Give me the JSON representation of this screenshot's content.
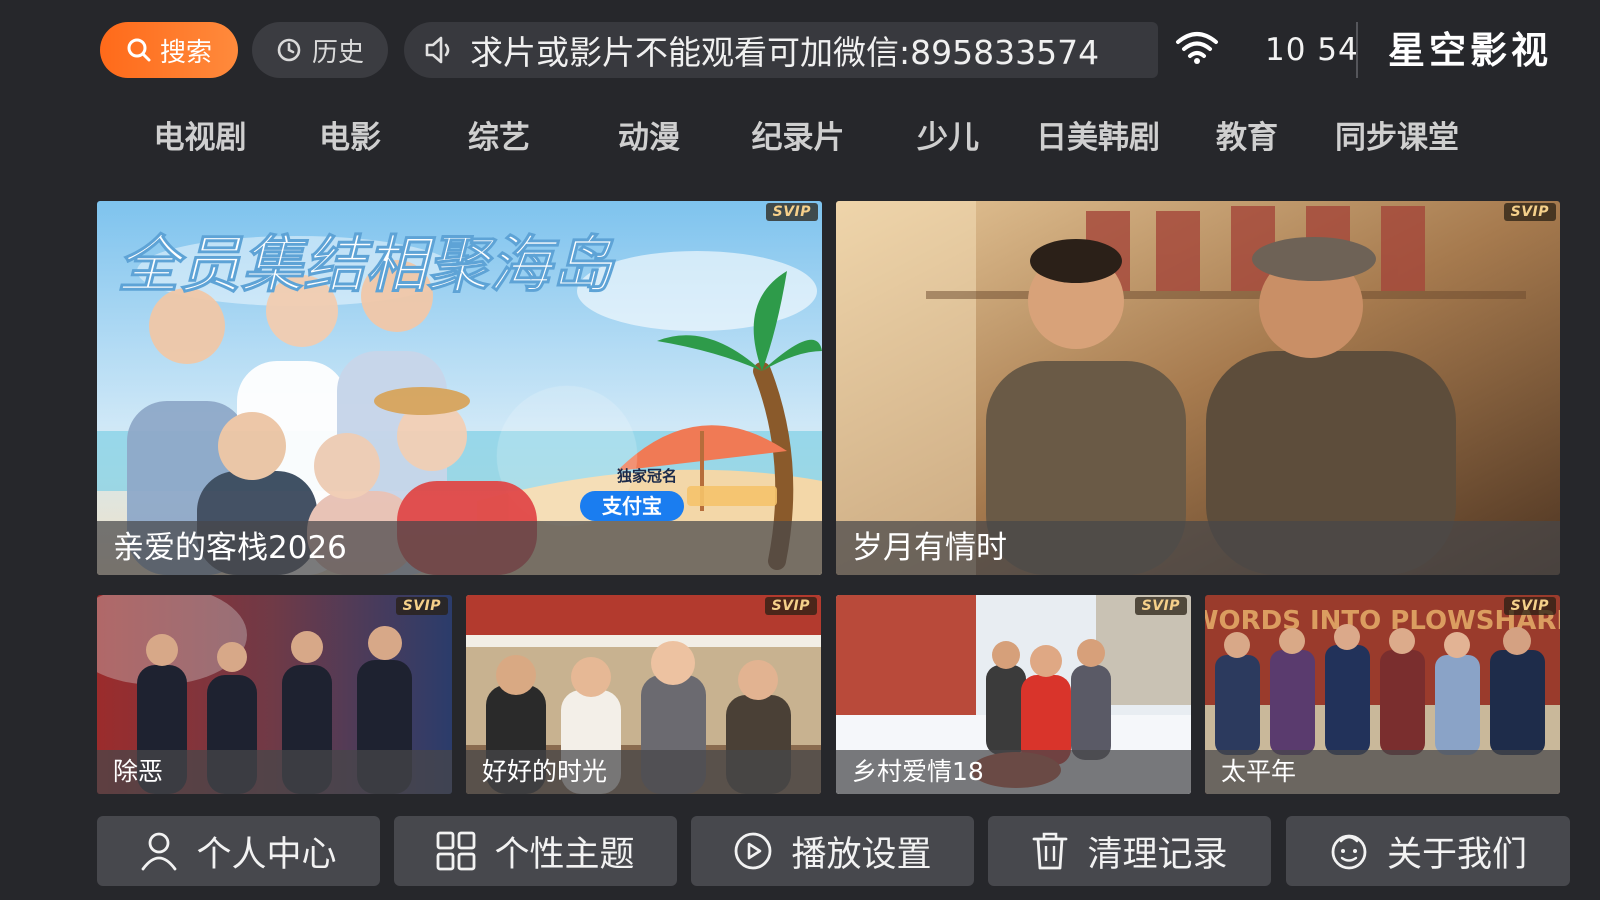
{
  "topbar": {
    "search_label": "搜索",
    "history_label": "历史",
    "notice_text": "求片或影片不能观看可加微信:895833574",
    "time": "10 54",
    "brand": "星空影视",
    "accent_color": "#ff6a1a"
  },
  "nav": {
    "items": [
      "电视剧",
      "电影",
      "综艺",
      "动漫",
      "纪录片",
      "少儿",
      "日美韩剧",
      "教育",
      "同步课堂"
    ]
  },
  "featured": [
    {
      "title": "亲爱的客栈2026",
      "badge": "SVIP",
      "poster_headline": "全员集结相聚海岛",
      "sponsor_top": "独家冠名",
      "sponsor": "支付宝"
    },
    {
      "title": "岁月有情时",
      "badge": "SVIP"
    }
  ],
  "small_tiles": [
    {
      "title": "除恶",
      "badge": "SVIP"
    },
    {
      "title": "好好的时光",
      "badge": "SVIP"
    },
    {
      "title": "乡村爱情18",
      "badge": "SVIP"
    },
    {
      "title": "太平年",
      "badge": "SVIP",
      "poster_text": "SWORDS INTO PLOWSHARES"
    }
  ],
  "bottom": {
    "profile": "个人中心",
    "theme": "个性主题",
    "playback": "播放设置",
    "clear": "清理记录",
    "about": "关于我们"
  }
}
